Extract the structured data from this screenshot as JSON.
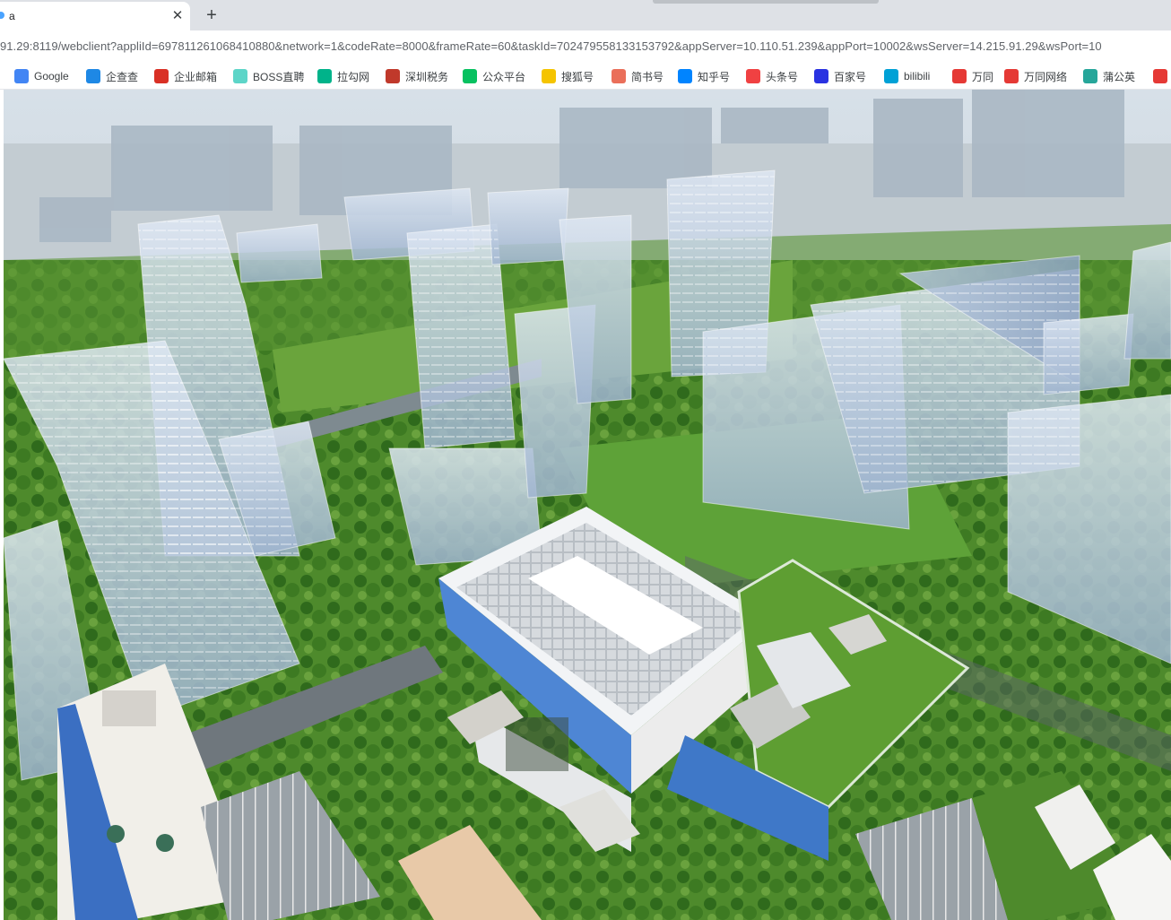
{
  "browser": {
    "tab": {
      "title": "a",
      "close_label": "✕"
    },
    "new_tab_label": "+",
    "url": "91.29:8119/webclient?appliId=697811261068410880&network=1&codeRate=8000&frameRate=60&taskId=702479558133153792&appServer=10.110.51.239&appPort=10002&wsServer=14.215.91.29&wsPort=10"
  },
  "bookmarks": [
    {
      "label": "Google",
      "icon": "google-icon",
      "color": "#4285f4"
    },
    {
      "label": "企查查",
      "icon": "qichacha-icon",
      "color": "#1e88e5"
    },
    {
      "label": "企业邮箱",
      "icon": "mail-icon",
      "color": "#d93025"
    },
    {
      "label": "BOSS直聘",
      "icon": "boss-icon",
      "color": "#5dd5c8"
    },
    {
      "label": "拉勾网",
      "icon": "lagou-icon",
      "color": "#00b38a"
    },
    {
      "label": "深圳税务",
      "icon": "tax-icon",
      "color": "#c0392b"
    },
    {
      "label": "公众平台",
      "icon": "wechat-icon",
      "color": "#07c160"
    },
    {
      "label": "搜狐号",
      "icon": "sohu-icon",
      "color": "#f5c400"
    },
    {
      "label": "简书号",
      "icon": "jianshu-icon",
      "color": "#ea6f5a"
    },
    {
      "label": "知乎号",
      "icon": "zhihu-icon",
      "color": "#0084ff"
    },
    {
      "label": "头条号",
      "icon": "toutiao-icon",
      "color": "#f04142"
    },
    {
      "label": "百家号",
      "icon": "baijia-icon",
      "color": "#2932e1"
    },
    {
      "label": "bilibili",
      "icon": "bilibili-icon",
      "color": "#00a1d6"
    },
    {
      "label": "万同",
      "icon": "wantong-icon",
      "color": "#e53935"
    },
    {
      "label": "万同网络",
      "icon": "wantong-network-icon",
      "color": "#e53935"
    },
    {
      "label": "蒲公英",
      "icon": "pgyer-icon",
      "color": "#26a69a"
    }
  ],
  "scene": {
    "description_icon": "3d-city-scene"
  }
}
